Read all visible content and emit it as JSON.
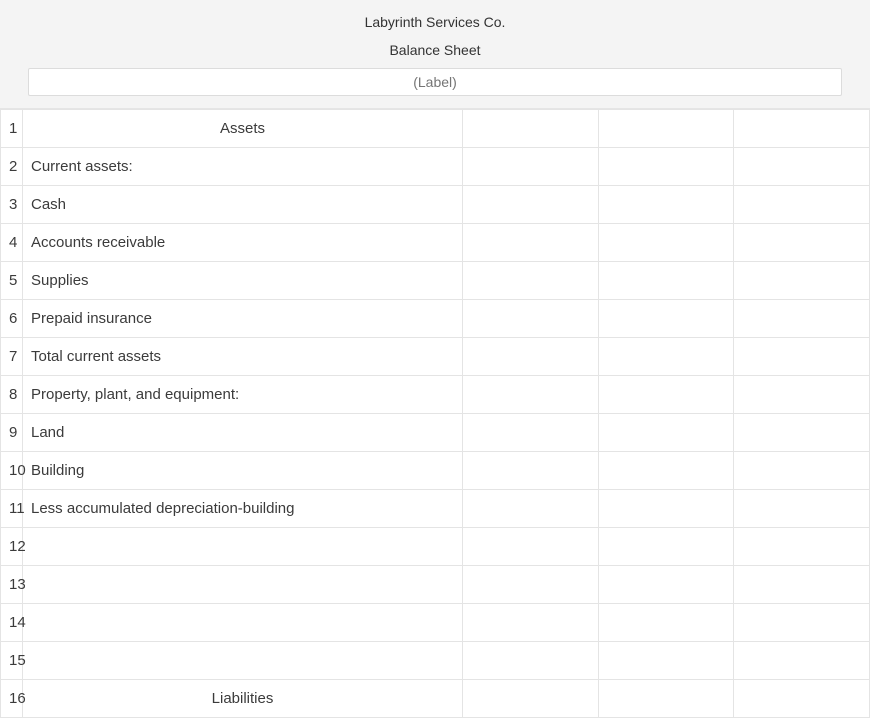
{
  "header": {
    "company": "Labyrinth Services Co.",
    "statement": "Balance Sheet",
    "label_placeholder": "(Label)"
  },
  "rows": [
    {
      "num": "1",
      "type": "section",
      "label": "Assets"
    },
    {
      "num": "2",
      "type": "line",
      "indent": 0,
      "label": "Current assets:"
    },
    {
      "num": "3",
      "type": "line",
      "indent": 1,
      "label": "Cash"
    },
    {
      "num": "4",
      "type": "line",
      "indent": 1,
      "label": "Accounts receivable"
    },
    {
      "num": "5",
      "type": "line",
      "indent": 1,
      "label": "Supplies"
    },
    {
      "num": "6",
      "type": "line",
      "indent": 1,
      "label": "Prepaid insurance"
    },
    {
      "num": "7",
      "type": "line",
      "indent": 2,
      "label": "Total current assets"
    },
    {
      "num": "8",
      "type": "line",
      "indent": 0,
      "label": "Property, plant, and equipment:"
    },
    {
      "num": "9",
      "type": "line",
      "indent": 1,
      "label": "Land"
    },
    {
      "num": "10",
      "type": "line",
      "indent": 1,
      "label": "Building"
    },
    {
      "num": "11",
      "type": "line",
      "indent": 2,
      "label": "Less accumulated depreciation-building"
    },
    {
      "num": "12",
      "type": "line",
      "indent": 0,
      "label": ""
    },
    {
      "num": "13",
      "type": "line",
      "indent": 0,
      "label": ""
    },
    {
      "num": "14",
      "type": "line",
      "indent": 0,
      "label": ""
    },
    {
      "num": "15",
      "type": "line",
      "indent": 0,
      "label": ""
    },
    {
      "num": "16",
      "type": "section",
      "label": "Liabilities"
    }
  ]
}
